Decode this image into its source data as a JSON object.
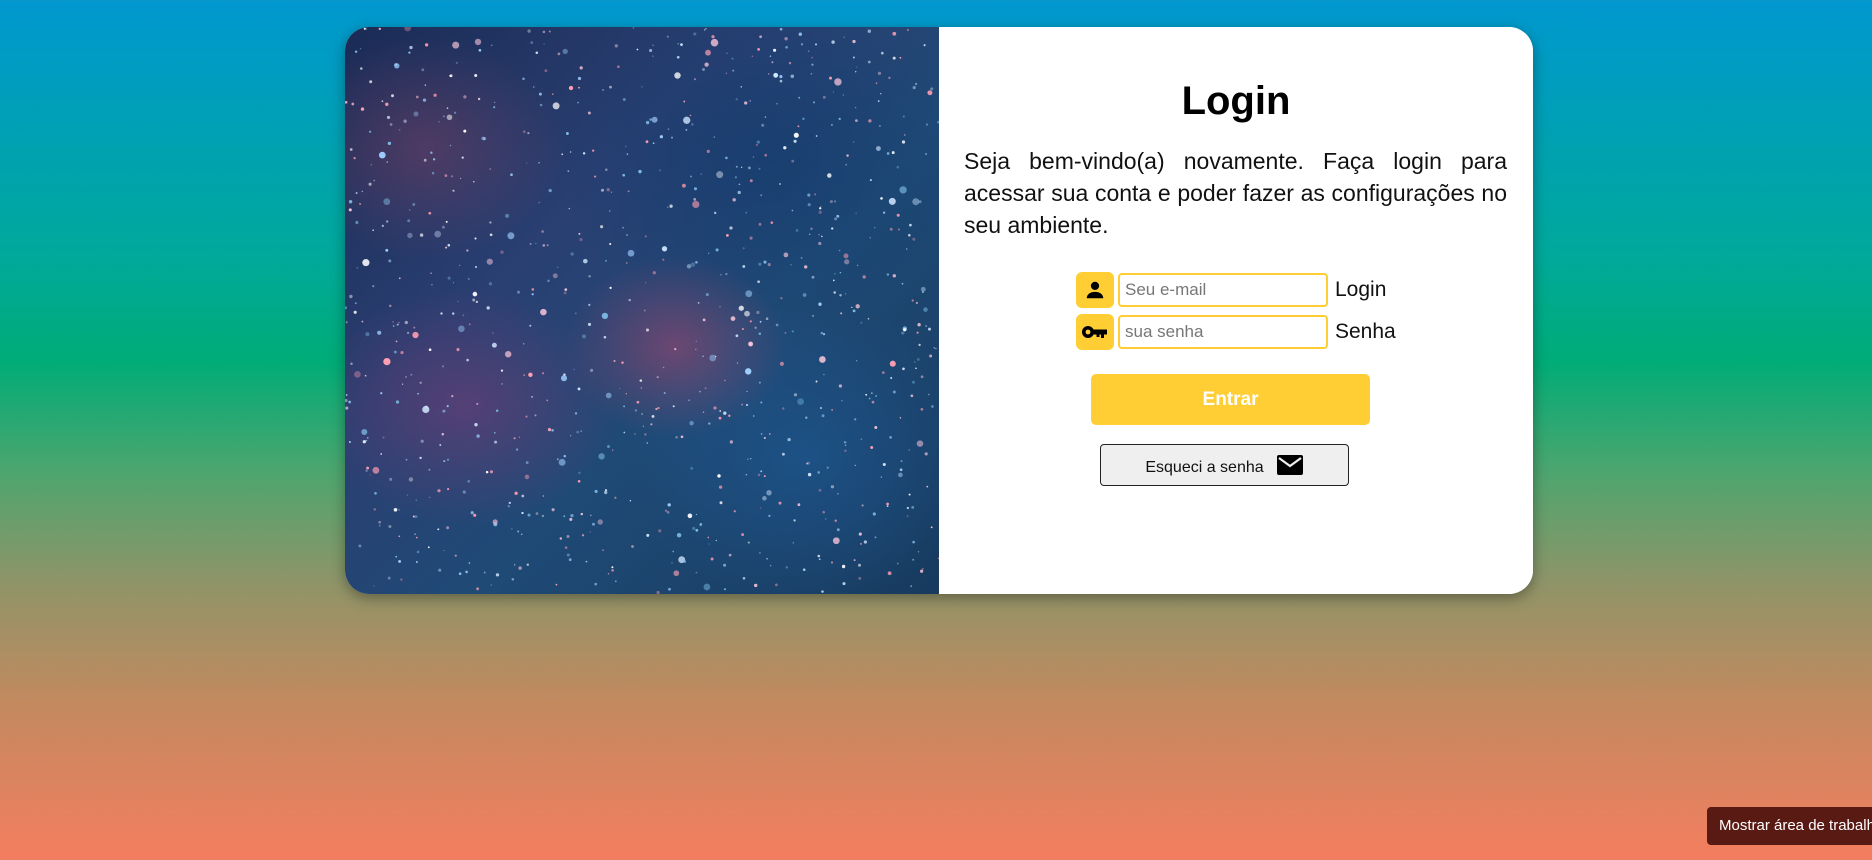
{
  "login": {
    "title": "Login",
    "intro": "Seja bem-vindo(a) novamente. Faça login para acessar sua conta e poder fazer as configurações no seu ambiente.",
    "email": {
      "icon": "user-icon",
      "placeholder": "Seu e-mail",
      "value": "",
      "label": "Login"
    },
    "password": {
      "icon": "key-icon",
      "placeholder": "sua senha",
      "value": "",
      "label": "Senha"
    },
    "submit_label": "Entrar",
    "forgot_label": "Esqueci a senha",
    "forgot_icon": "mail-icon"
  },
  "hero_image": {
    "description_icon": "galaxy-image"
  },
  "taskbar": {
    "show_desktop_tooltip": "Mostrar área de trabalho"
  },
  "colors": {
    "accent": "#ffce35",
    "panel": "#ffffff",
    "tooltip_bg": "#5a1a14",
    "gradient_top": "#0098cf",
    "gradient_mid": "#00ac77",
    "gradient_bottom": "#f47e5f"
  }
}
